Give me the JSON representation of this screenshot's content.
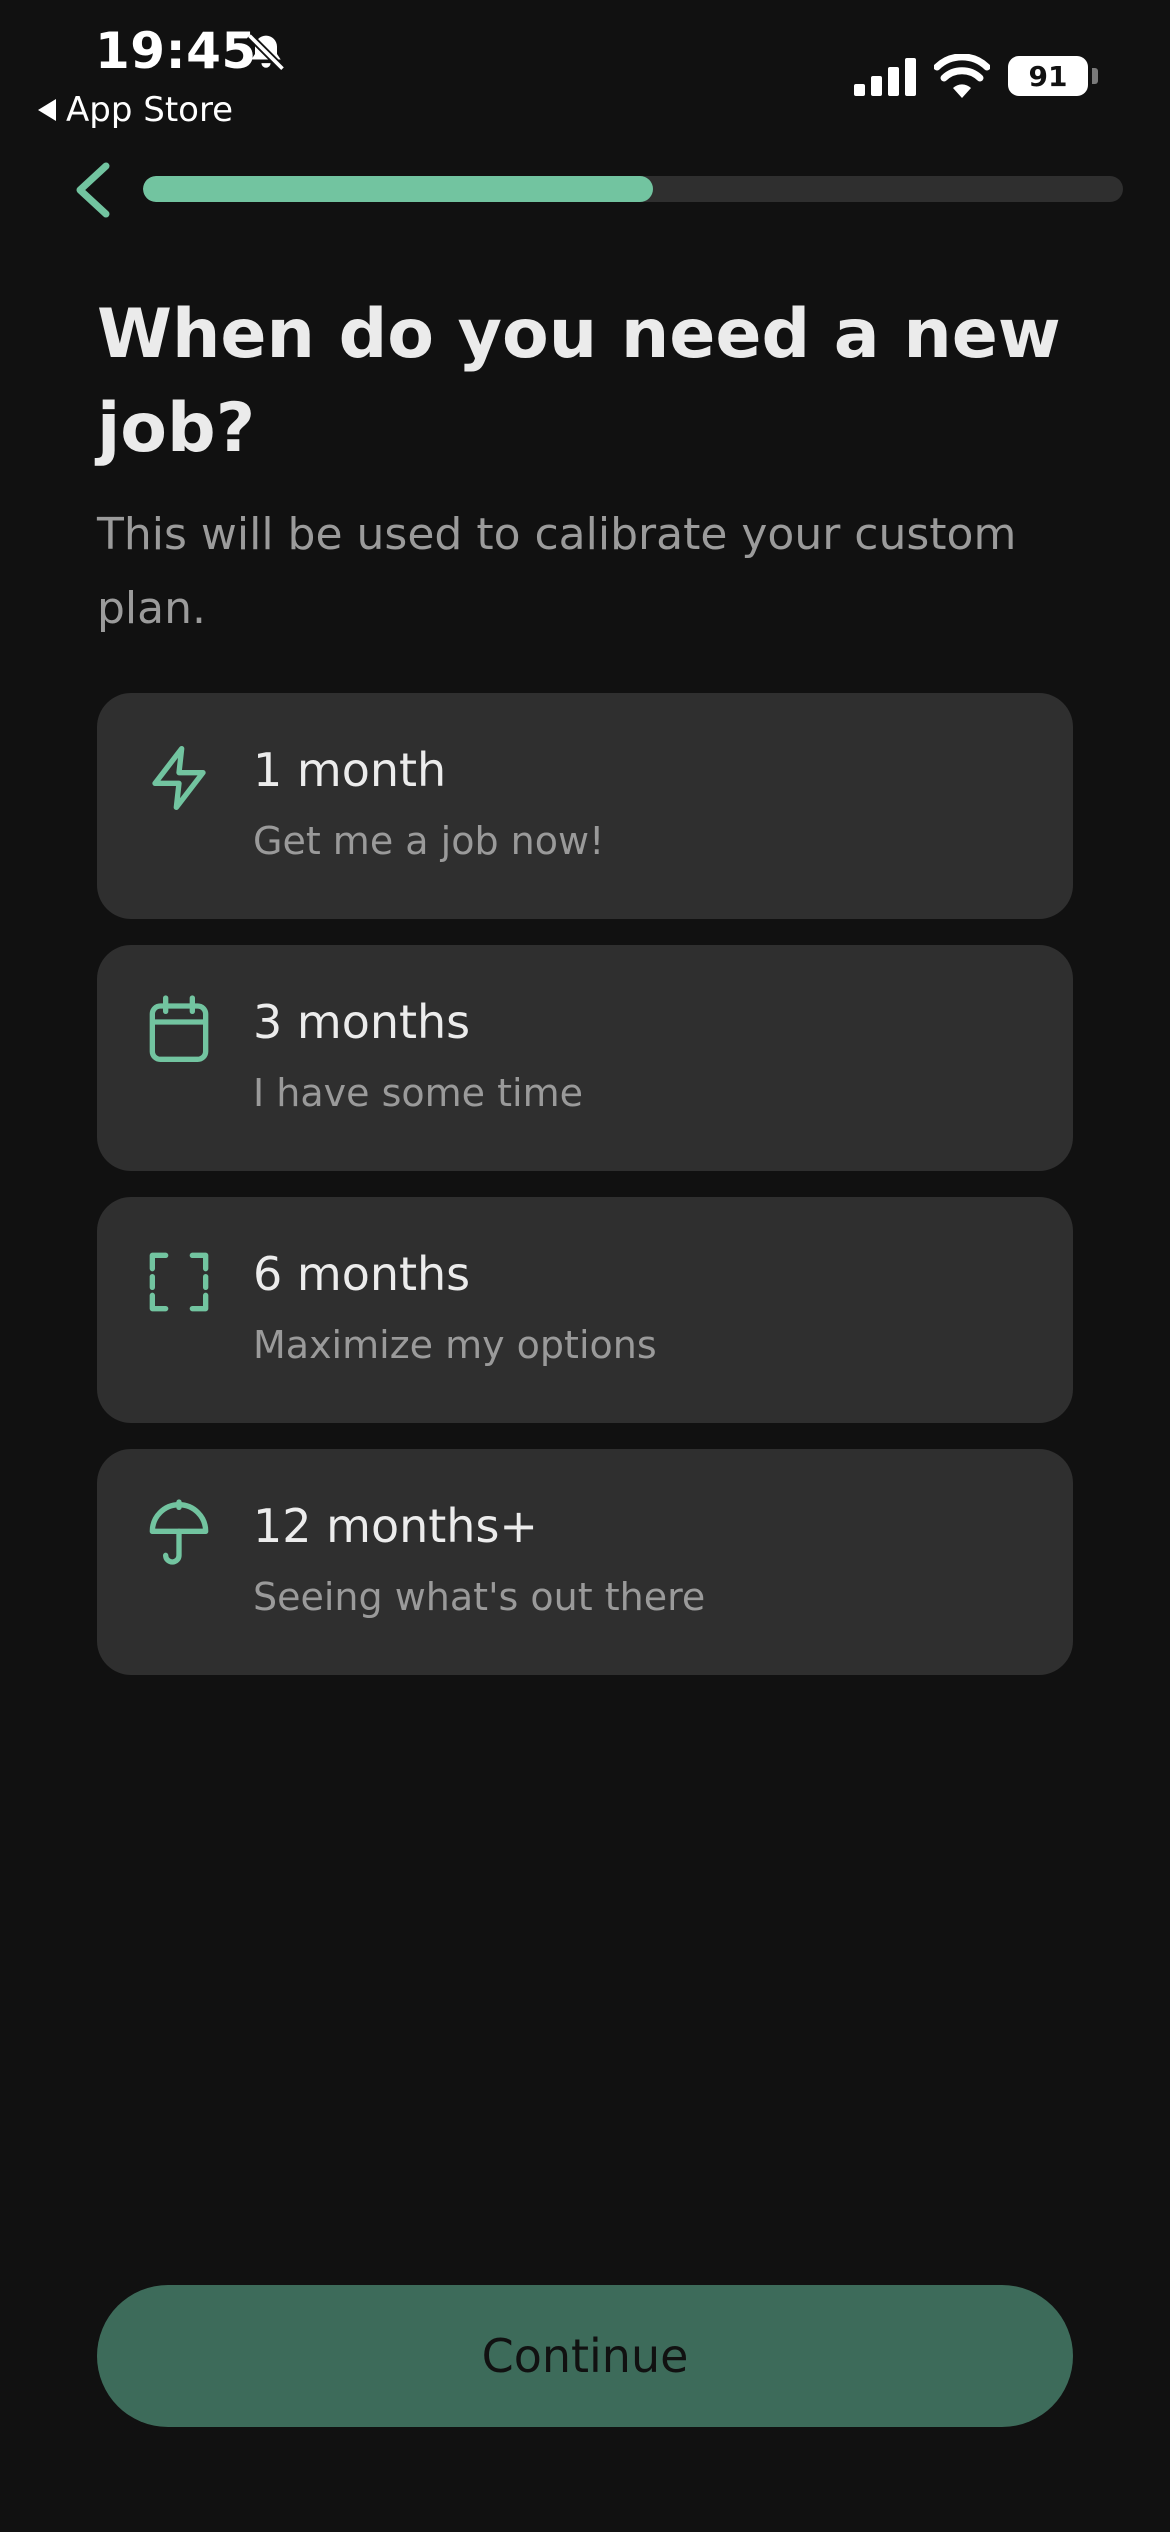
{
  "status_bar": {
    "time": "19:45",
    "back_app": "App Store",
    "battery": "91"
  },
  "progress": {
    "fraction": 0.52
  },
  "colors": {
    "accent": "#72c4a0",
    "card": "#2f2f2f",
    "background": "#111111",
    "button": "#3d6b5a"
  },
  "header": {
    "title": "When do you need a new job?",
    "subtitle": "This will be used to calibrate your custom plan."
  },
  "options": [
    {
      "icon": "lightning-icon",
      "label": "1 month",
      "description": "Get me a job now!"
    },
    {
      "icon": "calendar-icon",
      "label": "3 months",
      "description": "I have some time"
    },
    {
      "icon": "expand-icon",
      "label": "6 months",
      "description": "Maximize my options"
    },
    {
      "icon": "umbrella-icon",
      "label": "12 months+",
      "description": "Seeing what's out there"
    }
  ],
  "footer": {
    "continue_label": "Continue"
  }
}
